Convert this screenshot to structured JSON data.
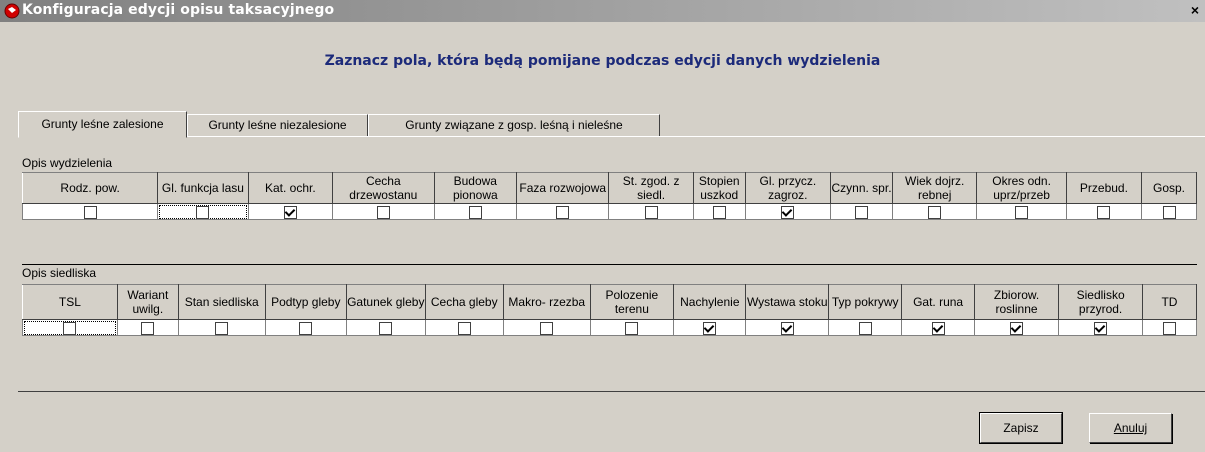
{
  "window": {
    "title": "Konfiguracja edycji opisu taksacyjnego",
    "close_label": "×"
  },
  "heading": "Zaznacz pola, która będą pomijane podczas edycji danych wydzielenia",
  "tabs": [
    {
      "label": "Grunty leśne zalesione",
      "active": true
    },
    {
      "label": "Grunty leśne niezalesione",
      "active": false
    },
    {
      "label": "Grunty związane z gosp. leśną i nieleśne",
      "active": false
    }
  ],
  "opis_wydzielenia": {
    "label": "Opis wydzielenia",
    "columns": [
      {
        "label": "Rodz. pow.",
        "checked": false
      },
      {
        "label": "Gl. funkcja lasu",
        "checked": false
      },
      {
        "label": "Kat. ochr.",
        "checked": true
      },
      {
        "label": "Cecha drzewostanu",
        "checked": false
      },
      {
        "label": "Budowa pionowa",
        "checked": false
      },
      {
        "label": "Faza rozwojowa",
        "checked": false
      },
      {
        "label": "St. zgod. z siedl.",
        "checked": false
      },
      {
        "label": "Stopien uszkod",
        "checked": false
      },
      {
        "label": "Gl. przycz. zagroz.",
        "checked": true
      },
      {
        "label": "Czynn. spr.",
        "checked": false
      },
      {
        "label": "Wiek dojrz. rebnej",
        "checked": false
      },
      {
        "label": "Okres odn. uprz/przeb",
        "checked": false
      },
      {
        "label": "Przebud.",
        "checked": false
      },
      {
        "label": "Gosp.",
        "checked": false
      }
    ]
  },
  "opis_siedliska": {
    "label": "Opis siedliska",
    "columns": [
      {
        "label": "TSL",
        "checked": false
      },
      {
        "label": "Wariant uwilg.",
        "checked": false
      },
      {
        "label": "Stan siedliska",
        "checked": false
      },
      {
        "label": "Podtyp gleby",
        "checked": false
      },
      {
        "label": "Gatunek gleby",
        "checked": false
      },
      {
        "label": "Cecha gleby",
        "checked": false
      },
      {
        "label": "Makro- rzezba",
        "checked": false
      },
      {
        "label": "Polozenie terenu",
        "checked": false
      },
      {
        "label": "Nachylenie",
        "checked": true
      },
      {
        "label": "Wystawa stoku",
        "checked": true
      },
      {
        "label": "Typ pokrywy",
        "checked": false
      },
      {
        "label": "Gat. runa",
        "checked": true
      },
      {
        "label": "Zbiorow. roslinne",
        "checked": true
      },
      {
        "label": "Siedlisko przyrod.",
        "checked": true
      },
      {
        "label": "TD",
        "checked": false
      }
    ]
  },
  "buttons": {
    "save": "Zapisz",
    "cancel": "Anuluj"
  }
}
